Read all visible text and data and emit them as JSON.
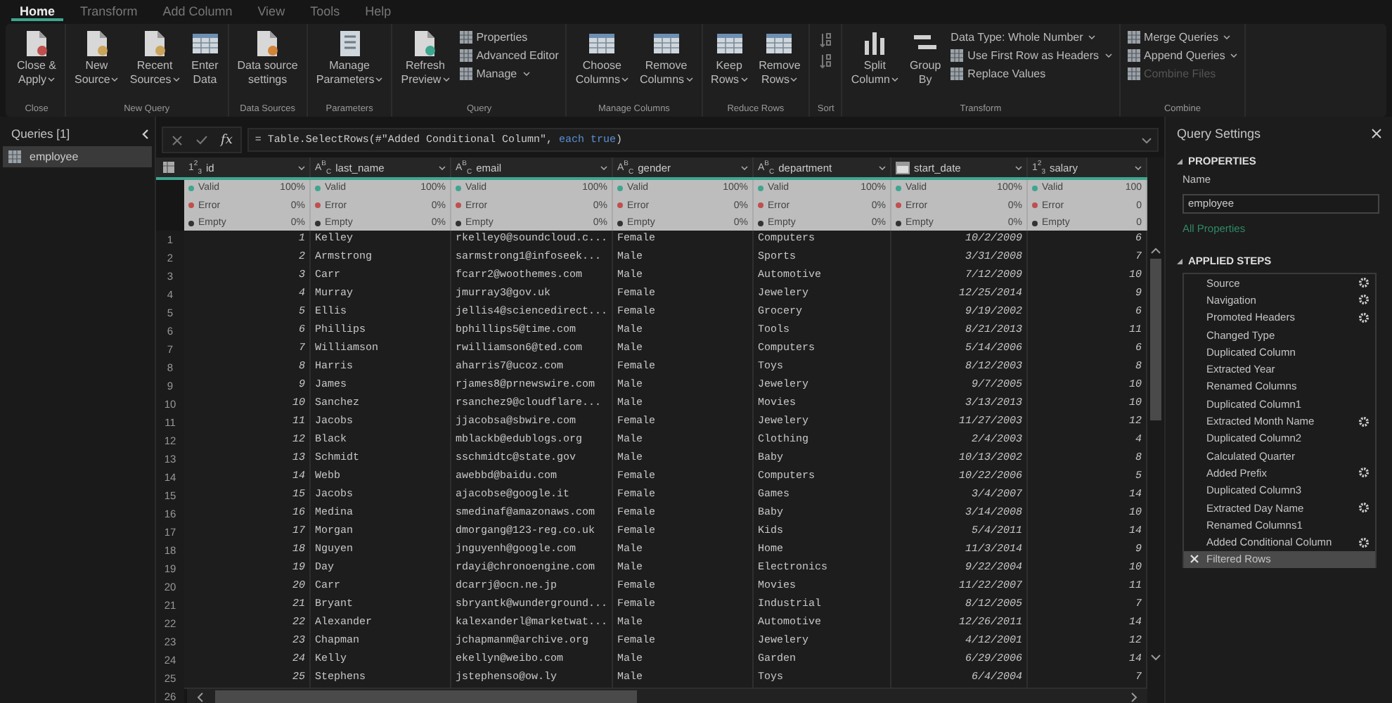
{
  "tabs": [
    {
      "label": "Home",
      "selected": true
    },
    {
      "label": "Transform",
      "selected": false
    },
    {
      "label": "Add Column",
      "selected": false
    },
    {
      "label": "View",
      "selected": false
    },
    {
      "label": "Tools",
      "selected": false
    },
    {
      "label": "Help",
      "selected": false
    }
  ],
  "ribbon": [
    {
      "label": "Close",
      "items": [
        {
          "kind": "large",
          "lines": [
            "Close &",
            "Apply"
          ],
          "dropdown": true
        }
      ]
    },
    {
      "label": "New Query",
      "items": [
        {
          "kind": "large",
          "lines": [
            "New",
            "Source"
          ],
          "dropdown": true
        },
        {
          "kind": "large",
          "lines": [
            "Recent",
            "Sources"
          ],
          "dropdown": true
        },
        {
          "kind": "large",
          "lines": [
            "Enter",
            "Data"
          ],
          "dropdown": false
        }
      ]
    },
    {
      "label": "Data Sources",
      "items": [
        {
          "kind": "large",
          "lines": [
            "Data source",
            "settings"
          ],
          "dropdown": false
        }
      ]
    },
    {
      "label": "Parameters",
      "items": [
        {
          "kind": "large",
          "lines": [
            "Manage",
            "Parameters"
          ],
          "dropdown": true
        }
      ]
    },
    {
      "label": "Query",
      "items": [
        {
          "kind": "large",
          "lines": [
            "Refresh",
            "Preview"
          ],
          "dropdown": true
        },
        {
          "kind": "stack",
          "items": [
            {
              "label": "Properties",
              "has_icon": true,
              "dropdown": false,
              "disabled": false
            },
            {
              "label": "Advanced Editor",
              "has_icon": true,
              "dropdown": false,
              "disabled": false
            },
            {
              "label": "Manage",
              "has_icon": true,
              "dropdown": true,
              "disabled": false
            }
          ]
        }
      ]
    },
    {
      "label": "Manage Columns",
      "items": [
        {
          "kind": "large",
          "lines": [
            "Choose",
            "Columns"
          ],
          "dropdown": true
        },
        {
          "kind": "large",
          "lines": [
            "Remove",
            "Columns"
          ],
          "dropdown": true
        }
      ]
    },
    {
      "label": "Reduce Rows",
      "items": [
        {
          "kind": "large",
          "lines": [
            "Keep",
            "Rows"
          ],
          "dropdown": true
        },
        {
          "kind": "large",
          "lines": [
            "Remove",
            "Rows"
          ],
          "dropdown": true
        }
      ]
    },
    {
      "label": "Sort",
      "items": [
        {
          "kind": "sort"
        }
      ]
    },
    {
      "label": "Transform",
      "items": [
        {
          "kind": "large",
          "lines": [
            "Split",
            "Column"
          ],
          "dropdown": true
        },
        {
          "kind": "large",
          "lines": [
            "Group",
            "By"
          ],
          "dropdown": false
        },
        {
          "kind": "stack",
          "items": [
            {
              "label": "Data Type: Whole Number",
              "has_icon": false,
              "dropdown": true,
              "disabled": false
            },
            {
              "label": "Use First Row as Headers",
              "has_icon": true,
              "dropdown": true,
              "disabled": false
            },
            {
              "label": "Replace Values",
              "has_icon": true,
              "dropdown": false,
              "disabled": false
            }
          ]
        }
      ]
    },
    {
      "label": "Combine",
      "items": [
        {
          "kind": "stack",
          "items": [
            {
              "label": "Merge Queries",
              "has_icon": true,
              "dropdown": true,
              "disabled": false
            },
            {
              "label": "Append Queries",
              "has_icon": true,
              "dropdown": true,
              "disabled": false
            },
            {
              "label": "Combine Files",
              "has_icon": true,
              "dropdown": false,
              "disabled": true
            }
          ]
        }
      ]
    }
  ],
  "queries": {
    "title": "Queries [1]",
    "items": [
      {
        "label": "employee",
        "selected": true
      }
    ]
  },
  "formula_bar": {
    "fx": "fx",
    "code": "= Table.SelectRows(#\"Added Conditional Column\", ",
    "keyword": "each true",
    "code_end": ")"
  },
  "columns": [
    {
      "name": "id",
      "kind": "number",
      "type_label": "1$^{2}$$_{3}$",
      "profile": [
        {
          "label": "Valid",
          "value": "100%",
          "color": "#3fa58f"
        },
        {
          "label": "Error",
          "value": "0%",
          "color": "#c0504d"
        },
        {
          "label": "Empty",
          "value": "0%",
          "color": "#333333"
        }
      ]
    },
    {
      "name": "last_name",
      "kind": "text",
      "type_label": "A$^{B}$$_{C}$",
      "profile": [
        {
          "label": "Valid",
          "value": "100%",
          "color": "#3fa58f"
        },
        {
          "label": "Error",
          "value": "0%",
          "color": "#c0504d"
        },
        {
          "label": "Empty",
          "value": "0%",
          "color": "#333333"
        }
      ]
    },
    {
      "name": "email",
      "kind": "text",
      "type_label": "A$^{B}$$_{C}$",
      "profile": [
        {
          "label": "Valid",
          "value": "100%",
          "color": "#3fa58f"
        },
        {
          "label": "Error",
          "value": "0%",
          "color": "#c0504d"
        },
        {
          "label": "Empty",
          "value": "0%",
          "color": "#333333"
        }
      ]
    },
    {
      "name": "gender",
      "kind": "text",
      "type_label": "A$^{B}$$_{C}$",
      "profile": [
        {
          "label": "Valid",
          "value": "100%",
          "color": "#3fa58f"
        },
        {
          "label": "Error",
          "value": "0%",
          "color": "#c0504d"
        },
        {
          "label": "Empty",
          "value": "0%",
          "color": "#333333"
        }
      ]
    },
    {
      "name": "department",
      "kind": "text",
      "type_label": "A$^{B}$$_{C}$",
      "profile": [
        {
          "label": "Valid",
          "value": "100%",
          "color": "#3fa58f"
        },
        {
          "label": "Error",
          "value": "0%",
          "color": "#c0504d"
        },
        {
          "label": "Empty",
          "value": "0%",
          "color": "#333333"
        }
      ]
    },
    {
      "name": "start_date",
      "kind": "date",
      "profile": [
        {
          "label": "Valid",
          "value": "100%",
          "color": "#3fa58f"
        },
        {
          "label": "Error",
          "value": "0%",
          "color": "#c0504d"
        },
        {
          "label": "Empty",
          "value": "0%",
          "color": "#333333"
        }
      ]
    },
    {
      "name": "salary",
      "kind": "number",
      "type_label": "1$^{2}$$_{3}$",
      "profile": [
        {
          "label": "Valid",
          "value": "100",
          "color": "#3fa58f"
        },
        {
          "label": "Error",
          "value": "0",
          "color": "#c0504d"
        },
        {
          "label": "Empty",
          "value": "0",
          "color": "#333333"
        }
      ]
    }
  ],
  "rows": [
    {
      "n": "1",
      "cells": [
        "1",
        "Kelley",
        "rkelley0@soundcloud.c...",
        "Female",
        "Computers",
        "10/2/2009",
        "6"
      ]
    },
    {
      "n": "2",
      "cells": [
        "2",
        "Armstrong",
        "sarmstrong1@infoseek...",
        "Male",
        "Sports",
        "3/31/2008",
        "7"
      ]
    },
    {
      "n": "3",
      "cells": [
        "3",
        "Carr",
        "fcarr2@woothemes.com",
        "Male",
        "Automotive",
        "7/12/2009",
        "10"
      ]
    },
    {
      "n": "4",
      "cells": [
        "4",
        "Murray",
        "jmurray3@gov.uk",
        "Female",
        "Jewelery",
        "12/25/2014",
        "9"
      ]
    },
    {
      "n": "5",
      "cells": [
        "5",
        "Ellis",
        "jellis4@sciencedirect...",
        "Female",
        "Grocery",
        "9/19/2002",
        "6"
      ]
    },
    {
      "n": "6",
      "cells": [
        "6",
        "Phillips",
        "bphillips5@time.com",
        "Male",
        "Tools",
        "8/21/2013",
        "11"
      ]
    },
    {
      "n": "7",
      "cells": [
        "7",
        "Williamson",
        "rwilliamson6@ted.com",
        "Male",
        "Computers",
        "5/14/2006",
        "6"
      ]
    },
    {
      "n": "8",
      "cells": [
        "8",
        "Harris",
        "aharris7@ucoz.com",
        "Female",
        "Toys",
        "8/12/2003",
        "8"
      ]
    },
    {
      "n": "9",
      "cells": [
        "9",
        "James",
        "rjames8@prnewswire.com",
        "Male",
        "Jewelery",
        "9/7/2005",
        "10"
      ]
    },
    {
      "n": "10",
      "cells": [
        "10",
        "Sanchez",
        "rsanchez9@cloudflare...",
        "Male",
        "Movies",
        "3/13/2013",
        "10"
      ]
    },
    {
      "n": "11",
      "cells": [
        "11",
        "Jacobs",
        "jjacobsa@sbwire.com",
        "Female",
        "Jewelery",
        "11/27/2003",
        "12"
      ]
    },
    {
      "n": "12",
      "cells": [
        "12",
        "Black",
        "mblackb@edublogs.org",
        "Male",
        "Clothing",
        "2/4/2003",
        "4"
      ]
    },
    {
      "n": "13",
      "cells": [
        "13",
        "Schmidt",
        "sschmidtc@state.gov",
        "Male",
        "Baby",
        "10/13/2002",
        "8"
      ]
    },
    {
      "n": "14",
      "cells": [
        "14",
        "Webb",
        "awebbd@baidu.com",
        "Female",
        "Computers",
        "10/22/2006",
        "5"
      ]
    },
    {
      "n": "15",
      "cells": [
        "15",
        "Jacobs",
        "ajacobse@google.it",
        "Female",
        "Games",
        "3/4/2007",
        "14"
      ]
    },
    {
      "n": "16",
      "cells": [
        "16",
        "Medina",
        "smedinaf@amazonaws.com",
        "Female",
        "Baby",
        "3/14/2008",
        "10"
      ]
    },
    {
      "n": "17",
      "cells": [
        "17",
        "Morgan",
        "dmorgang@123-reg.co.uk",
        "Female",
        "Kids",
        "5/4/2011",
        "14"
      ]
    },
    {
      "n": "18",
      "cells": [
        "18",
        "Nguyen",
        "jnguyenh@google.com",
        "Male",
        "Home",
        "11/3/2014",
        "9"
      ]
    },
    {
      "n": "19",
      "cells": [
        "19",
        "Day",
        "rdayi@chronoengine.com",
        "Male",
        "Electronics",
        "9/22/2004",
        "10"
      ]
    },
    {
      "n": "20",
      "cells": [
        "20",
        "Carr",
        "dcarrj@ocn.ne.jp",
        "Female",
        "Movies",
        "11/22/2007",
        "11"
      ]
    },
    {
      "n": "21",
      "cells": [
        "21",
        "Bryant",
        "sbryantk@wunderground...",
        "Female",
        "Industrial",
        "8/12/2005",
        "7"
      ]
    },
    {
      "n": "22",
      "cells": [
        "22",
        "Alexander",
        "kalexanderl@marketwat...",
        "Male",
        "Automotive",
        "12/26/2011",
        "14"
      ]
    },
    {
      "n": "23",
      "cells": [
        "23",
        "Chapman",
        "jchapmanm@archive.org",
        "Female",
        "Jewelery",
        "4/12/2001",
        "12"
      ]
    },
    {
      "n": "24",
      "cells": [
        "24",
        "Kelly",
        "ekellyn@weibo.com",
        "Male",
        "Garden",
        "6/29/2006",
        "14"
      ]
    },
    {
      "n": "25",
      "cells": [
        "25",
        "Stephens",
        "jstephenso@ow.ly",
        "Male",
        "Toys",
        "6/4/2004",
        "7"
      ]
    }
  ],
  "last_row_number": "26",
  "query_settings": {
    "title": "Query Settings",
    "properties_heading": "PROPERTIES",
    "name_label": "Name",
    "name_value": "employee",
    "all_properties": "All Properties",
    "steps_heading": "APPLIED STEPS",
    "steps": [
      {
        "label": "Source",
        "has_settings": true,
        "selected": false
      },
      {
        "label": "Navigation",
        "has_settings": true,
        "selected": false
      },
      {
        "label": "Promoted Headers",
        "has_settings": true,
        "selected": false
      },
      {
        "label": "Changed Type",
        "has_settings": false,
        "selected": false
      },
      {
        "label": "Duplicated Column",
        "has_settings": false,
        "selected": false
      },
      {
        "label": "Extracted Year",
        "has_settings": false,
        "selected": false
      },
      {
        "label": "Renamed Columns",
        "has_settings": false,
        "selected": false
      },
      {
        "label": "Duplicated Column1",
        "has_settings": false,
        "selected": false
      },
      {
        "label": "Extracted Month Name",
        "has_settings": true,
        "selected": false
      },
      {
        "label": "Duplicated Column2",
        "has_settings": false,
        "selected": false
      },
      {
        "label": "Calculated Quarter",
        "has_settings": false,
        "selected": false
      },
      {
        "label": "Added Prefix",
        "has_settings": true,
        "selected": false
      },
      {
        "label": "Duplicated Column3",
        "has_settings": false,
        "selected": false
      },
      {
        "label": "Extracted Day Name",
        "has_settings": true,
        "selected": false
      },
      {
        "label": "Renamed Columns1",
        "has_settings": false,
        "selected": false
      },
      {
        "label": "Added Conditional Column",
        "has_settings": true,
        "selected": false
      },
      {
        "label": "Filtered Rows",
        "has_settings": false,
        "selected": true
      }
    ]
  }
}
